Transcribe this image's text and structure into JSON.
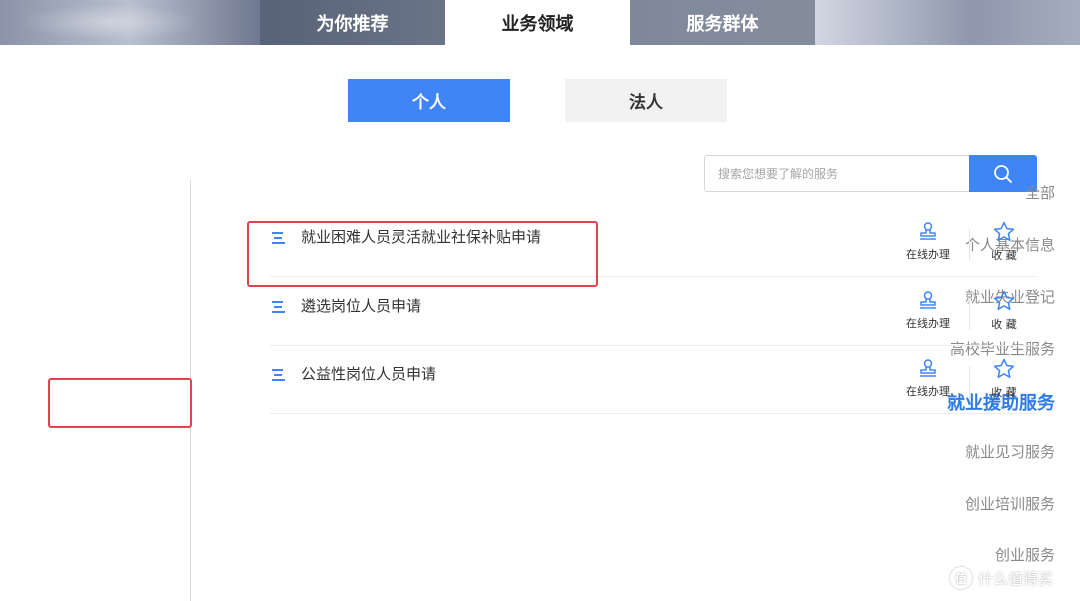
{
  "top_tabs": [
    {
      "label": "为你推荐",
      "active": false
    },
    {
      "label": "业务领域",
      "active": true
    },
    {
      "label": "服务群体",
      "active": false
    }
  ],
  "audience_toggle": {
    "person_label": "个人",
    "legal_label": "法人",
    "selected": "个人"
  },
  "search": {
    "placeholder": "搜索您想要了解的服务",
    "icon": "search-icon"
  },
  "sidebar": {
    "items": [
      {
        "label": "全部"
      },
      {
        "label": "个人基本信息"
      },
      {
        "label": "就业失业登记"
      },
      {
        "label": "高校毕业生服务"
      },
      {
        "label": "就业援助服务",
        "active": true
      },
      {
        "label": "就业见习服务"
      },
      {
        "label": "创业培训服务"
      },
      {
        "label": "创业服务"
      }
    ]
  },
  "services": [
    {
      "title": "就业困难人员灵活就业社保补贴申请",
      "online_label": "在线办理",
      "fav_label": "收 藏"
    },
    {
      "title": "遴选岗位人员申请",
      "online_label": "在线办理",
      "fav_label": "收 藏"
    },
    {
      "title": "公益性岗位人员申请",
      "online_label": "在线办理",
      "fav_label": "收 藏"
    }
  ],
  "watermark": {
    "text": "什么值得买",
    "icon_text": "值"
  },
  "colors": {
    "accent": "#3f85f5",
    "active_sidebar": "#2f7be6",
    "highlight_border": "#e0434b"
  }
}
